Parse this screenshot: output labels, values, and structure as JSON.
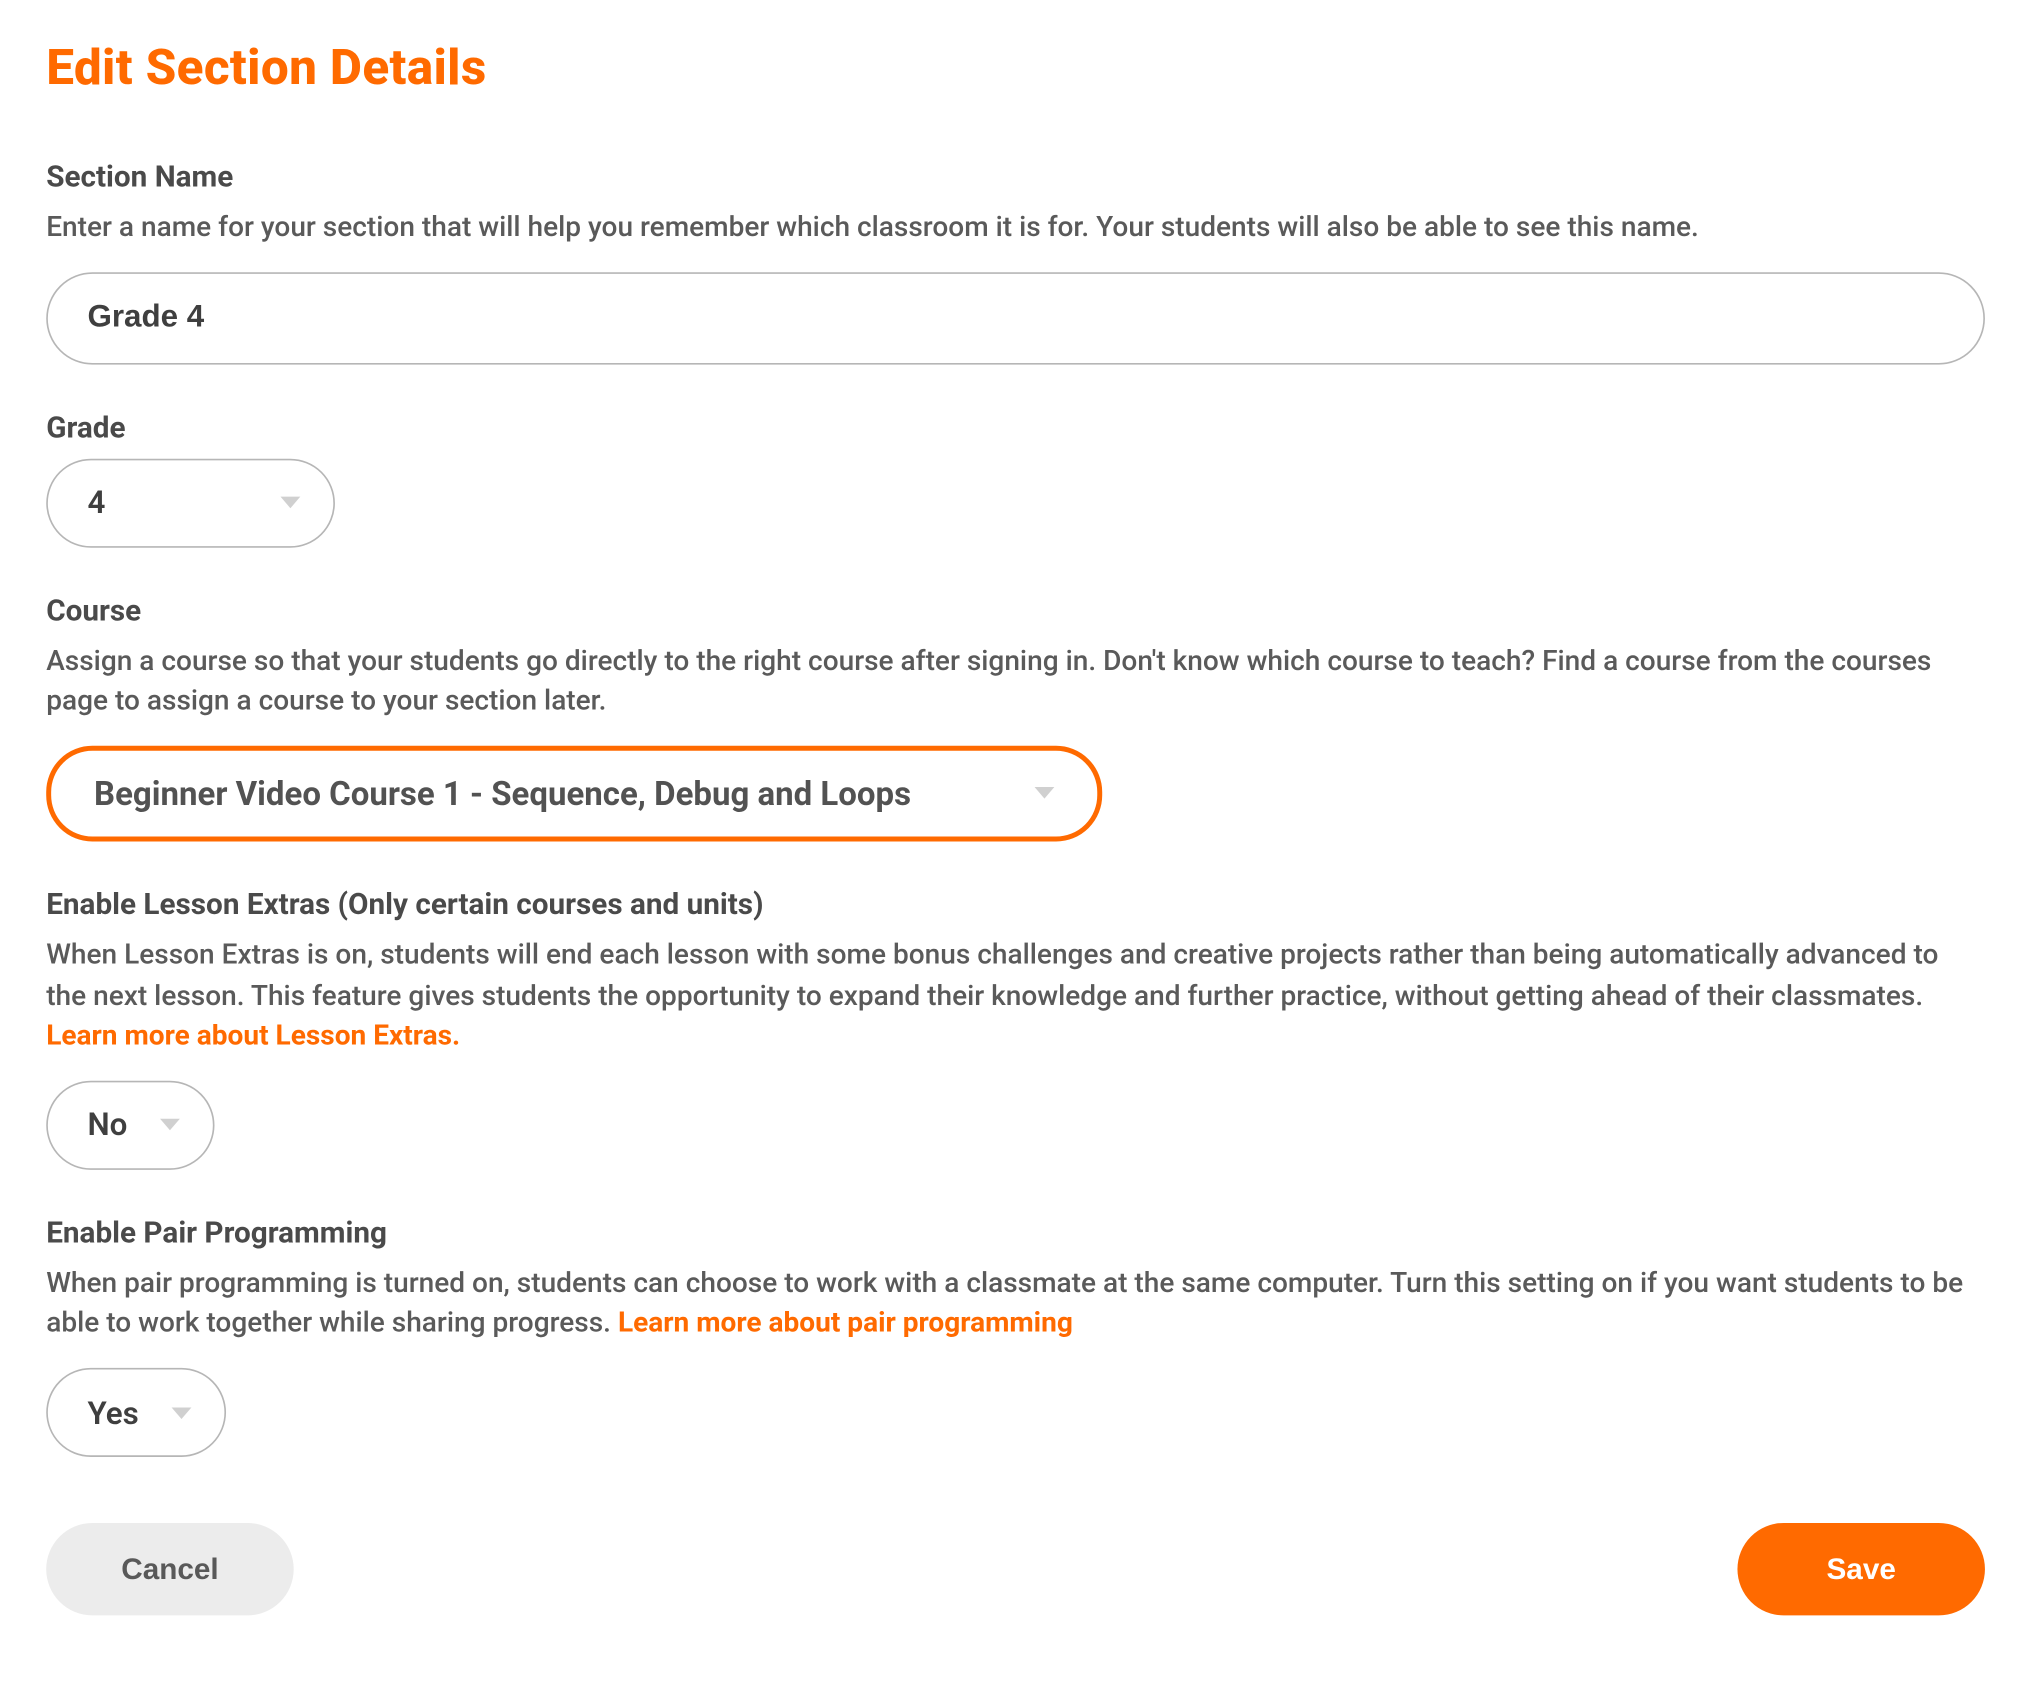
{
  "title": "Edit Section Details",
  "sectionName": {
    "label": "Section Name",
    "help": "Enter a name for your section that will help you remember which classroom it is for. Your students will also be able to see this name.",
    "value": "Grade 4"
  },
  "grade": {
    "label": "Grade",
    "value": "4"
  },
  "course": {
    "label": "Course",
    "help": "Assign a course so that your students go directly to the right course after signing in. Don't know which course to teach? Find a course from the courses page to assign a course to your section later.",
    "value": "Beginner Video Course 1 - Sequence, Debug and Loops"
  },
  "lessonExtras": {
    "label": "Enable Lesson Extras (Only certain courses and units)",
    "helpPrefix": "When Lesson Extras is on, students will end each lesson with some bonus challenges and creative projects rather than being automatically advanced to the next lesson. This feature gives students the opportunity to expand their knowledge and further practice, without getting ahead of their classmates. ",
    "link": "Learn more about Lesson Extras.",
    "value": "No"
  },
  "pairProgramming": {
    "label": "Enable Pair Programming",
    "helpPrefix": "When pair programming is turned on, students can choose to work with a classmate at the same computer. Turn this setting on if you want students to be able to work together while sharing progress. ",
    "link": "Learn more about pair programming",
    "value": "Yes"
  },
  "buttons": {
    "cancel": "Cancel",
    "save": "Save"
  }
}
